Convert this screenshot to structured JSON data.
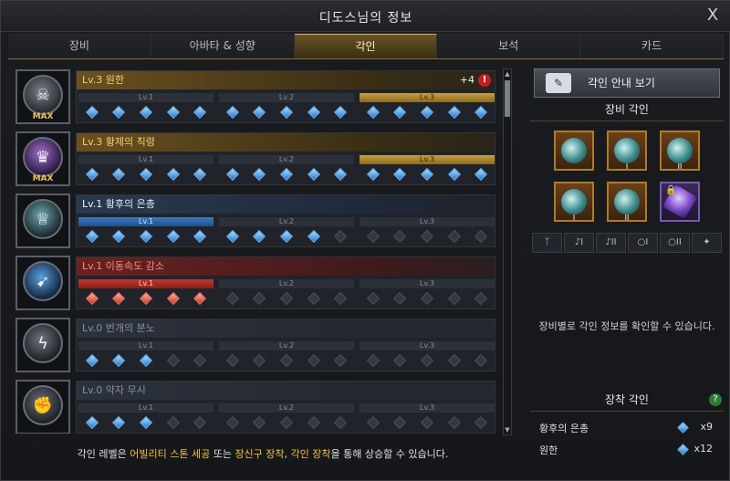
{
  "window": {
    "title": "디도스님의 정보",
    "close_label": "X"
  },
  "tabs": [
    {
      "label": "장비"
    },
    {
      "label": "아바타 & 성향"
    },
    {
      "label": "각인"
    },
    {
      "label": "보석"
    },
    {
      "label": "카드"
    }
  ],
  "level_labels": [
    "Lv.1",
    "Lv.2",
    "Lv.3"
  ],
  "engravings": [
    {
      "name": "Lv.3 원한",
      "badge": "MAX",
      "extra": "+4",
      "alert": "!"
    },
    {
      "name": "Lv.3 황제의 칙령",
      "badge": "MAX"
    },
    {
      "name": "Lv.1 황후의 은총"
    },
    {
      "name": "Lv.1 이동속도 감소"
    },
    {
      "name": "Lv.0 번개의 분노"
    },
    {
      "name": "Lv.0 약자 무시"
    }
  ],
  "footer": {
    "prefix": "각인 레벨은 ",
    "h1": "어빌리티 스톤 세공",
    "mid1": " 또는 ",
    "h2": "장신구 장착",
    "mid2": ", ",
    "h3": "각인 장착",
    "suffix": "을 통해 상승할 수 있습니다."
  },
  "right": {
    "guide_button": "각인 안내 보기",
    "equip_title": "장비 각인",
    "slot_romans": [
      "",
      "I",
      "II",
      "I",
      "II",
      ""
    ],
    "slot_icon_labels": [
      "",
      "I",
      "II",
      "I",
      "II",
      ""
    ],
    "info_text": "장비별로 각인 정보를 확인할 수 있습니다.",
    "mounted_title": "장착 각인",
    "help_label": "?",
    "owned": [
      {
        "name": "황후의 은총",
        "count": "x9"
      },
      {
        "name": "원한",
        "count": "x12"
      }
    ]
  },
  "colors": {
    "accent_gold": "#d8b060",
    "gem_blue": "#2a7ad0",
    "gem_red": "#c83a28"
  }
}
